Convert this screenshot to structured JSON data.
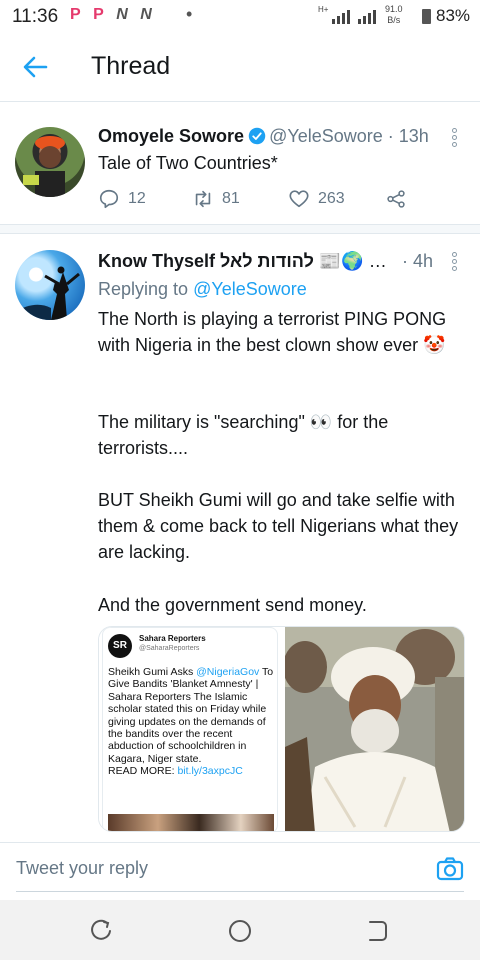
{
  "status_bar": {
    "time": "11:36",
    "network": "H+",
    "speed_value": "91.0",
    "speed_unit": "B/s",
    "battery": "83%"
  },
  "header": {
    "title": "Thread"
  },
  "tweets": [
    {
      "name": "Omoyele Sowore",
      "handle": "@YeleSowore",
      "time": "13h",
      "text": "Tale of Two Countries*",
      "replies": "12",
      "retweets": "81",
      "likes": "263"
    },
    {
      "name": "Know Thyself להודות לאל",
      "name_extra": "📰🌍 …",
      "time": "4h",
      "replying_prefix": "Replying to",
      "replying_handle": "@YeleSowore",
      "paragraphs": [
        "The North is playing a terrorist PING PONG with Nigeria in the best clown show ever 🤡",
        "The military is \"searching\" 👀 for the terrorists....",
        "BUT Sheikh Gumi will go and take selfie with them & come back to tell Nigerians what they are lacking.",
        "And the government send money."
      ],
      "embed": {
        "logo": "SR",
        "name": "Sahara Reporters",
        "handle": "@SaharaReporters",
        "text_before": "Sheikh Gumi Asks ",
        "text_mention": "@NigeriaGov",
        "text_after": " To Give Bandits 'Blanket Amnesty' | Sahara Reporters The Islamic scholar stated this on Friday while giving updates on the demands of the bandits over the recent abduction of schoolchildren in Kagara, Niger state.",
        "read_more": "READ MORE: ",
        "link": "bit.ly/3axpcJC"
      }
    }
  ],
  "reply_bar": {
    "placeholder": "Tweet your reply"
  },
  "colors": {
    "accent": "#1da1f2",
    "text": "#14171a",
    "secondary": "#657786"
  }
}
